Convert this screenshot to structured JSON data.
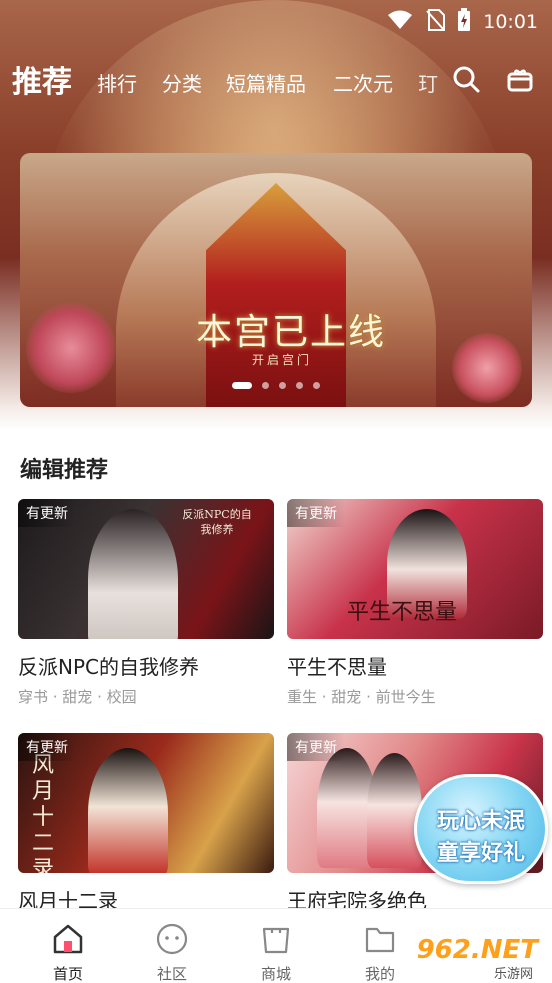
{
  "status_bar": {
    "time": "10:01"
  },
  "top_nav": {
    "tabs": [
      "推荐",
      "排行",
      "分类",
      "短篇精品",
      "二次元",
      "玎"
    ],
    "active_tab": "推荐"
  },
  "banner": {
    "title": "本宫已上线",
    "subtitle": "开启宫门",
    "slide_count": 5,
    "active_slide": 1
  },
  "section": {
    "title": "编辑推荐"
  },
  "books": [
    {
      "badge": "有更新",
      "cover_text": "反派NPC的自我修养",
      "title": "反派NPC的自我修养",
      "tags": "穿书 · 甜宠 · 校园"
    },
    {
      "badge": "有更新",
      "cover_text": "平生不思量",
      "title": "平生不思量",
      "tags": "重生 · 甜宠 · 前世今生"
    },
    {
      "badge": "有更新",
      "cover_text": "风月十二录",
      "title": "风月十二录",
      "tags": ""
    },
    {
      "badge": "有更新",
      "cover_text": "",
      "title": "王府宅院多绝色",
      "tags": ""
    }
  ],
  "promo": {
    "line1": "玩心未泯",
    "line2": "童享好礼"
  },
  "bottom_nav": {
    "items": [
      "首页",
      "社区",
      "商城",
      "我的"
    ],
    "active": "首页"
  },
  "watermark": {
    "number": "962.NET",
    "site": "乐游网"
  },
  "colors": {
    "accent": "#ff4f6e",
    "text": "#222222",
    "muted": "#999999"
  }
}
